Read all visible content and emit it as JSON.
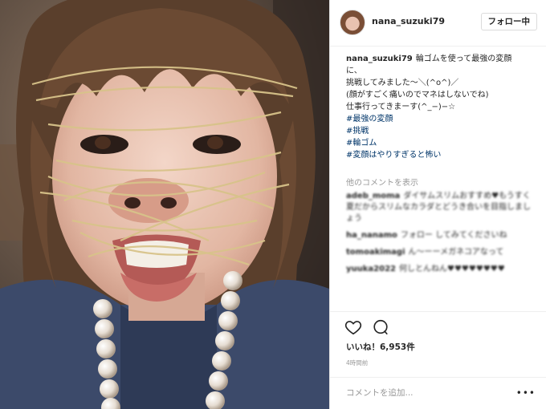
{
  "post": {
    "username": "nana_suzuki79",
    "follow_label": "フォロー中"
  },
  "caption": {
    "username": "nana_suzuki79",
    "lines": [
      "輪ゴムを使って最強の変顔",
      "に、",
      "挑戦してみました〜＼(^o^)／",
      "(顔がすごく痛いのでマネはしないでね)",
      "仕事行ってきまーす(^_−)−☆"
    ],
    "hashtags": [
      "#最強の変顔",
      "#挑戦",
      "#輪ゴム",
      "#変顔はやりすぎると怖い"
    ]
  },
  "comments": {
    "more_label": "他のコメントを表示",
    "items": [
      {
        "user": "adeb_moma",
        "text": "ダイサムスリムおすすめ♥もうすく夏だからスリムなカラダとどうき合いを目指しましょう"
      },
      {
        "user": "ha_nanamo",
        "text": "フォロー してみてくださいね"
      },
      {
        "user": "tomoakimagi",
        "text": "ん〜ーーメガネコアなって"
      },
      {
        "user": "yuuka2022",
        "text": "何しとんねん♥♥♥♥♥♥♥♥"
      }
    ]
  },
  "actions": {
    "likes": "いいね！6,953件",
    "timestamp": "4時間前",
    "heart_icon": "heart-outline-icon",
    "comment_icon": "comment-bubble-icon"
  },
  "add_comment": {
    "placeholder": "コメントを追加...",
    "more_label": "•••"
  },
  "colors": {
    "hashtag": "#003569",
    "muted": "#999999",
    "text": "#262626"
  }
}
